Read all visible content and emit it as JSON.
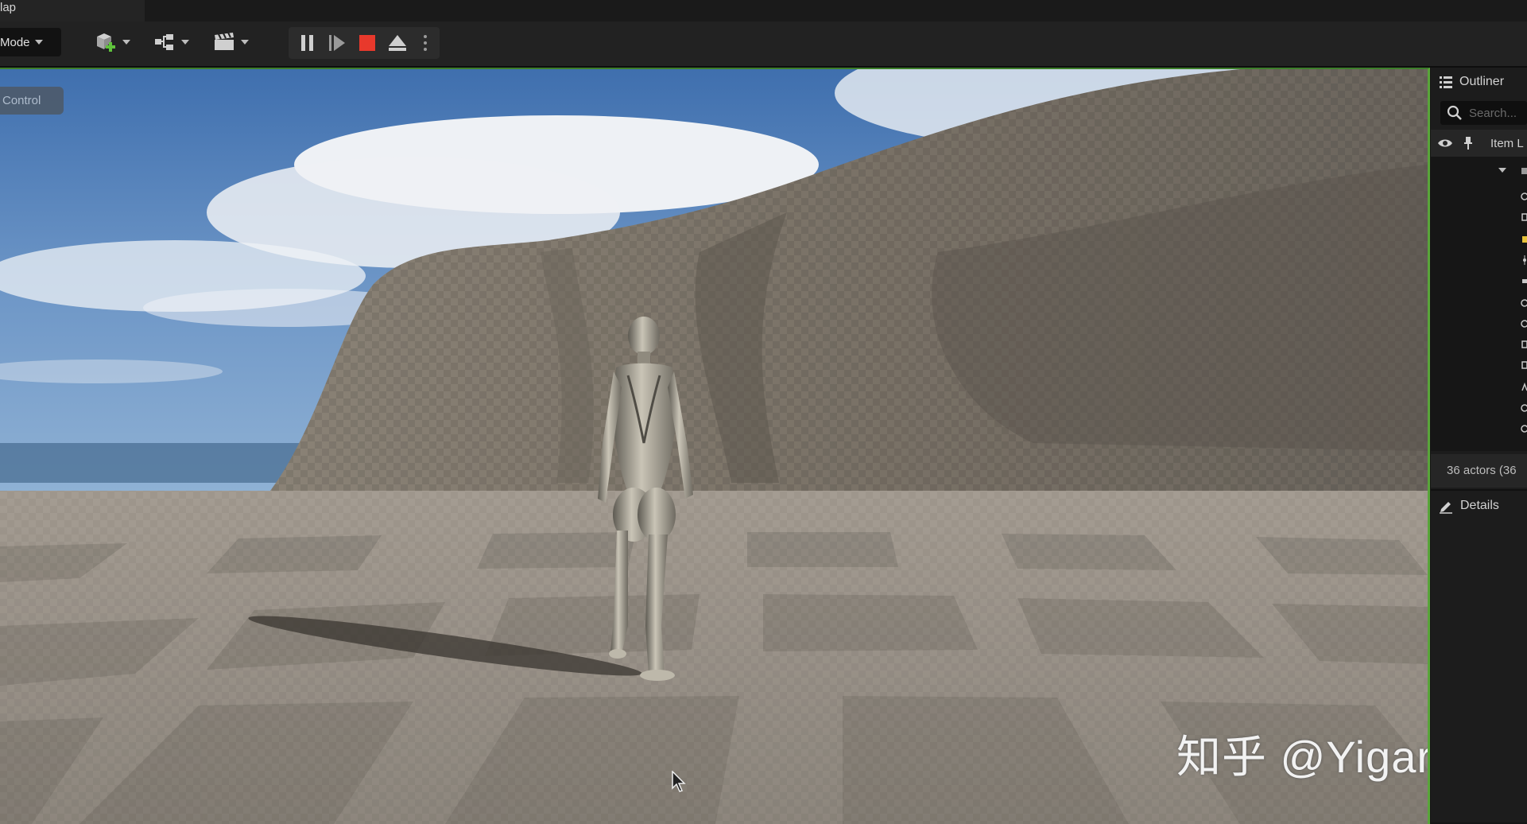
{
  "titlebar": {
    "map_tab_label": "lap"
  },
  "toolbar": {
    "mode_label": "Mode",
    "add_icon": "cube-plus-icon",
    "blueprint_icon": "blueprint-nodes-icon",
    "cinematics_icon": "clapperboard-icon",
    "play_controls": {
      "pause_icon": "pause-icon",
      "advance_icon": "frame-advance-icon",
      "stop_icon": "stop-icon",
      "eject_icon": "eject-icon",
      "more_icon": "more-vertical-icon",
      "stop_color": "#e8392c"
    }
  },
  "viewport": {
    "control_label": "Control",
    "watermark": "知乎 @Yigarlor",
    "accent_border_color": "#59a53a"
  },
  "outliner": {
    "title": "Outliner",
    "search_placeholder": "Search...",
    "column_label": "Item L",
    "actors_count": "36 actors (36"
  },
  "details": {
    "title": "Details"
  }
}
